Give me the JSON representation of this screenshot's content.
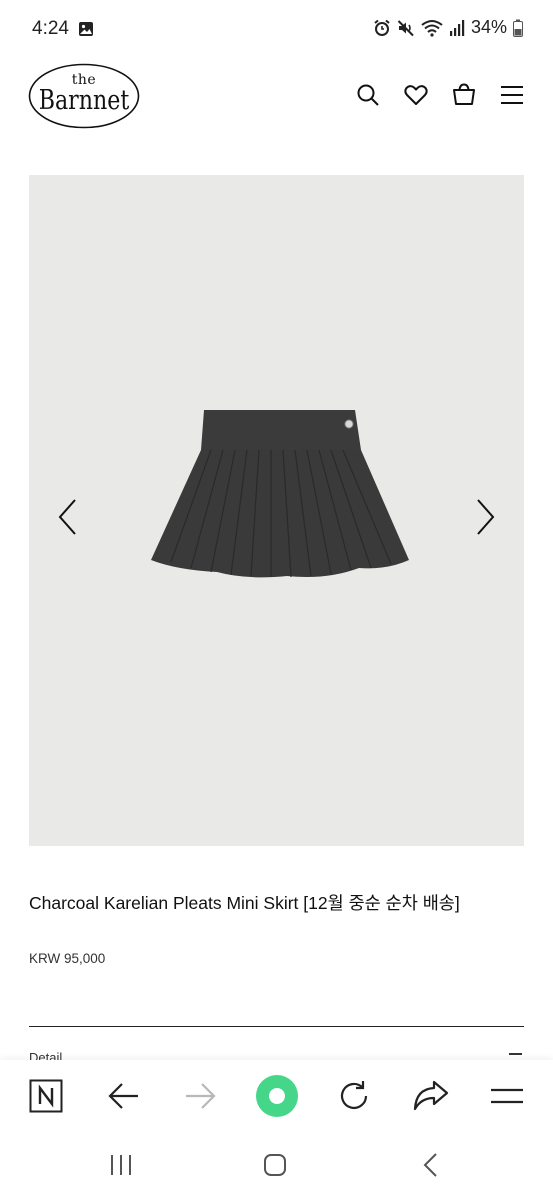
{
  "status_bar": {
    "time": "4:24",
    "battery": "34%",
    "icons": [
      "gallery-icon",
      "alarm-icon",
      "mute-icon",
      "wifi-icon",
      "signal-icon",
      "battery-icon"
    ]
  },
  "header": {
    "logo_the": "the",
    "logo_name": "Barnnet",
    "icons": [
      "search-icon",
      "heart-icon",
      "shopping-bag-icon",
      "menu-icon"
    ]
  },
  "product": {
    "title": "Charcoal Karelian Pleats Mini Skirt [12월 중순 순차 배송]",
    "price": "KRW 95,000",
    "detail_label": "Detail",
    "image_background": "#e9e9e7",
    "skirt_color": "#3a3a3a"
  },
  "browser_toolbar": {
    "icons": [
      "naver-icon",
      "back-arrow-icon",
      "forward-arrow-icon",
      "green-dot-icon",
      "refresh-icon",
      "share-icon",
      "menu-icon"
    ],
    "accent": "#45d68a"
  },
  "android_nav": {
    "icons": [
      "recent-apps-icon",
      "home-icon",
      "back-icon"
    ]
  }
}
